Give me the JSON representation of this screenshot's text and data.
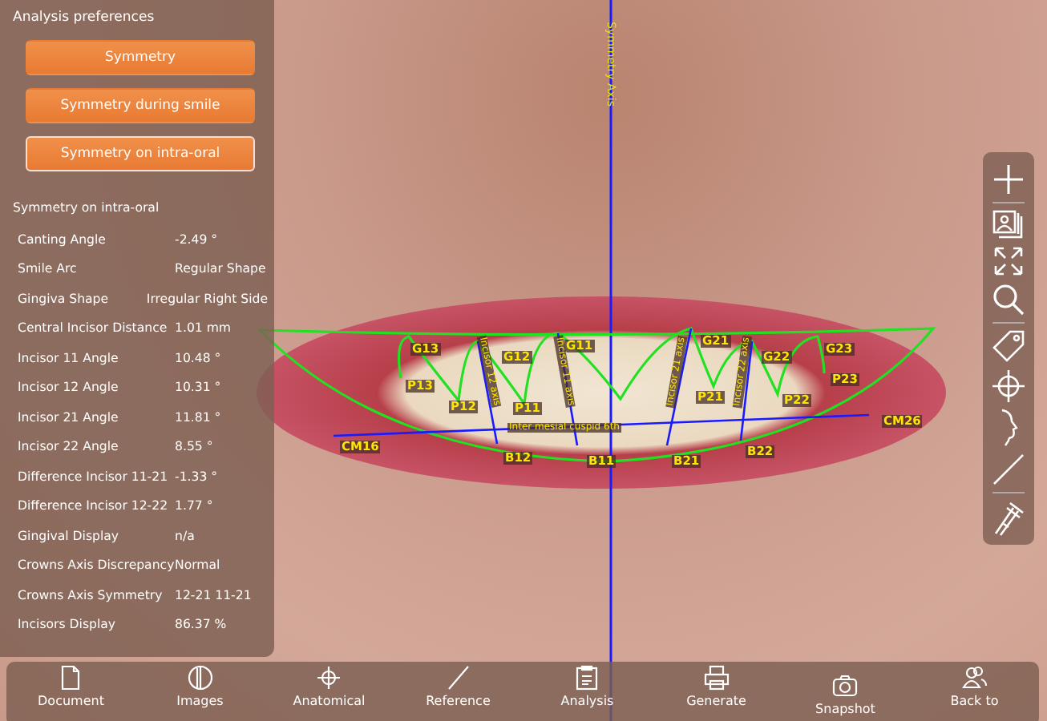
{
  "sidebar": {
    "title": "Analysis preferences",
    "buttons": [
      {
        "label": "Symmetry",
        "selected": false
      },
      {
        "label": "Symmetry during smile",
        "selected": false
      },
      {
        "label": "Symmetry on intra-oral",
        "selected": true
      }
    ],
    "results_title": "Symmetry on intra-oral",
    "results": [
      {
        "label": "Canting Angle",
        "value": "-2.49 °"
      },
      {
        "label": "Smile Arc",
        "value": "Regular Shape"
      },
      {
        "label": "Gingiva Shape",
        "value": "Irregular Right Side"
      },
      {
        "label": "Central Incisor Distance",
        "value": "1.01 mm"
      },
      {
        "label": "Incisor 11 Angle",
        "value": "10.48 °"
      },
      {
        "label": "Incisor 12 Angle",
        "value": "10.31 °"
      },
      {
        "label": "Incisor 21 Angle",
        "value": "11.81 °"
      },
      {
        "label": "Incisor 22 Angle",
        "value": "8.55 °"
      },
      {
        "label": "Difference Incisor 11-21",
        "value": "-1.33 °"
      },
      {
        "label": "Difference Incisor 12-22",
        "value": "1.77 °"
      },
      {
        "label": "Gingival Display",
        "value": "n/a"
      },
      {
        "label": "Crowns Axis Discrepancy",
        "value": "Normal"
      },
      {
        "label": "Crowns Axis Symmetry",
        "value": "12-21 11-21"
      },
      {
        "label": "Incisors Display",
        "value": "86.37 %"
      }
    ]
  },
  "canvas": {
    "symmetry_axis_label": "Symmetry Axis",
    "point_labels": [
      "G13",
      "G12",
      "G11",
      "G21",
      "G22",
      "G23",
      "P13",
      "P12",
      "P11",
      "P21",
      "P22",
      "P23",
      "CM16",
      "CM26",
      "B12",
      "B11",
      "B21",
      "B22"
    ],
    "line_labels": [
      "Incisor 12 axis",
      "Incisor 11 axis",
      "Incisor 21 axis",
      "Incisor 22 axis",
      "Inter mesial cuspid 6th"
    ]
  },
  "bottom_toolbar": {
    "items": [
      "Document",
      "Images",
      "Anatomical",
      "Reference",
      "Analysis",
      "Generate",
      "Snapshot",
      "Back to"
    ]
  }
}
